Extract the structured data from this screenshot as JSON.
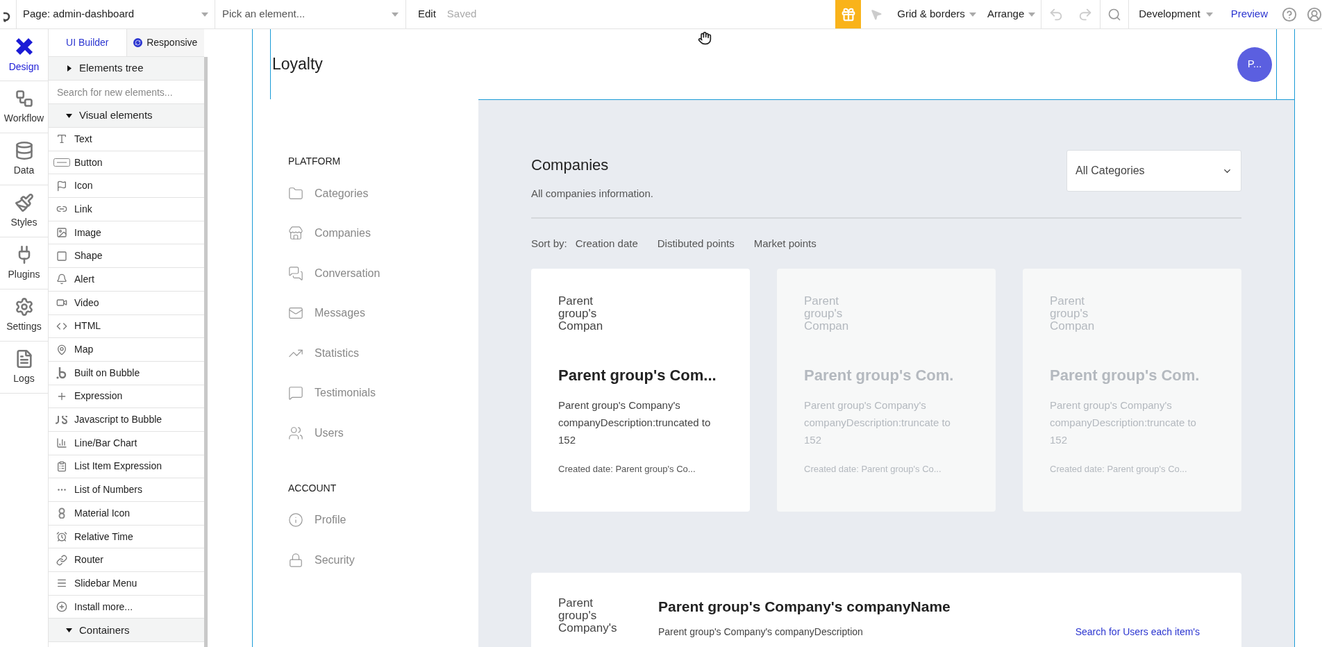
{
  "topbar": {
    "page_select": "Page: admin-dashboard",
    "element_select": {
      "placeholder": "Pick an element..."
    },
    "edit": "Edit",
    "saved": "Saved",
    "grid": "Grid & borders",
    "arrange": "Arrange",
    "mode": "Development",
    "preview": "Preview"
  },
  "left_nav": [
    {
      "label": "Design",
      "selected": true
    },
    {
      "label": "Workflow",
      "selected": false
    },
    {
      "label": "Data",
      "selected": false
    },
    {
      "label": "Styles",
      "selected": false
    },
    {
      "label": "Plugins",
      "selected": false
    },
    {
      "label": "Settings",
      "selected": false
    },
    {
      "label": "Logs",
      "selected": false
    }
  ],
  "elements_panel": {
    "tabs": [
      {
        "label": "UI Builder",
        "selected": true
      },
      {
        "label": "Responsive",
        "selected": false
      }
    ],
    "tree": {
      "label": "Elements tree",
      "expanded": false
    },
    "search": {
      "placeholder": "Search for new elements..."
    },
    "sections": [
      {
        "label": "Visual elements",
        "expanded": true,
        "items": [
          "Text",
          "Button",
          "Icon",
          "Link",
          "Image",
          "Shape",
          "Alert",
          "Video",
          "HTML",
          "Map",
          "Built on Bubble",
          "Expression",
          "Javascript to Bubble",
          "Line/Bar Chart",
          "List Item Expression",
          "List of Numbers",
          "Material Icon",
          "Relative Time",
          "Router",
          "Slidebar Menu",
          "Install more..."
        ]
      },
      {
        "label": "Containers",
        "expanded": true
      }
    ]
  },
  "page": {
    "app_title": "Loyalty",
    "avatar": "P...",
    "nav_sections": [
      {
        "heading": "PLATFORM",
        "items": [
          "Categories",
          "Companies",
          "Conversation",
          "Messages",
          "Statistics",
          "Testimonials",
          "Users"
        ]
      },
      {
        "heading": "ACCOUNT",
        "items": [
          "Profile",
          "Security"
        ]
      }
    ],
    "content": {
      "title": "Companies",
      "subtitle": "All companies information.",
      "category_select": "All Categories",
      "sort_label": "Sort by:",
      "sort_options": [
        "Creation date",
        "Distibuted points",
        "Market points"
      ],
      "cards": [
        {
          "image_text": "Parent group's Compan",
          "title": "Parent group's Com...",
          "description": "Parent group's Company's companyDescription:truncated to 152",
          "created": "Created date: Parent group's Co...",
          "faded": false
        },
        {
          "image_text": "Parent group's Compan",
          "title": "Parent group's Com.",
          "description": "Parent group's Company's companyDescription:truncate to 152",
          "created": "Created date: Parent group's Co...",
          "faded": true
        },
        {
          "image_text": "Parent group's Compan",
          "title": "Parent group's Com.",
          "description": "Parent group's Company's companyDescription:truncate to 152",
          "created": "Created date: Parent group's Co...",
          "faded": true
        }
      ],
      "detail_card": {
        "image_text": "Parent group's Company's",
        "title": "Parent group's Company's companyName",
        "description": "Parent group's Company's companyDescription",
        "link": "Search for Users each item's"
      }
    }
  }
}
